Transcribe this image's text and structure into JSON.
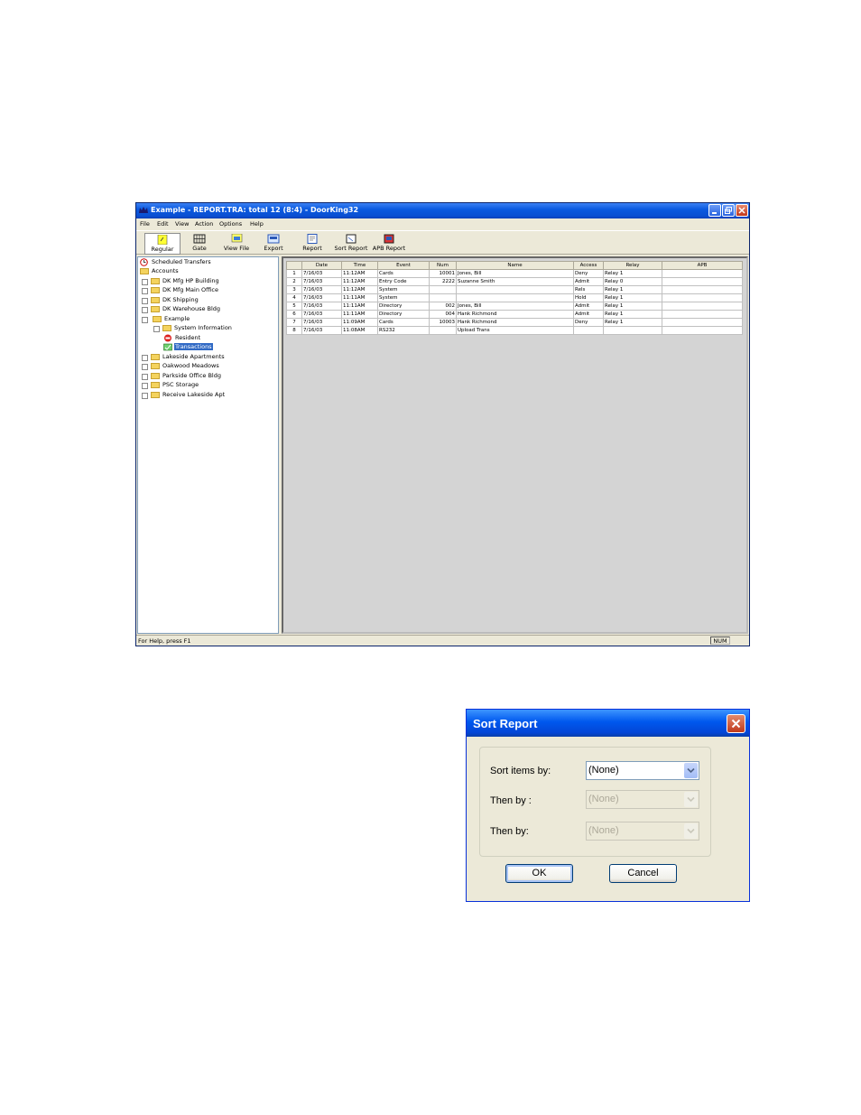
{
  "window": {
    "title": "Example - REPORT.TRA: total 12 (8:4) - DoorKing32",
    "menu": [
      "File",
      "Edit",
      "View",
      "Action",
      "Options",
      "Help"
    ],
    "toolbar": [
      {
        "label": "Regular",
        "icon": "regular-icon"
      },
      {
        "label": "Gate",
        "icon": "gate-icon"
      },
      {
        "label": "View File",
        "icon": "view-file-icon"
      },
      {
        "label": "Export",
        "icon": "export-icon"
      },
      {
        "label": "Report",
        "icon": "report-icon"
      },
      {
        "label": "Sort Report",
        "icon": "sort-report-icon"
      },
      {
        "label": "APB Report",
        "icon": "apb-report-icon"
      }
    ],
    "tree": [
      {
        "label": "Scheduled Transfers"
      },
      {
        "label": "Accounts"
      },
      {
        "label": "DK Mfg HP Building"
      },
      {
        "label": "DK Mfg Main Office"
      },
      {
        "label": "DK Shipping"
      },
      {
        "label": "DK Warehouse Bldg"
      },
      {
        "label": "Example"
      },
      {
        "label": "System Information"
      },
      {
        "label": "Resident"
      },
      {
        "label": "Transactions"
      },
      {
        "label": "Lakeside Apartments"
      },
      {
        "label": "Oakwood Meadows"
      },
      {
        "label": "Parkside Office Bldg"
      },
      {
        "label": "PSC Storage"
      },
      {
        "label": "Receive Lakeside Apt"
      }
    ],
    "grid": {
      "columns": [
        "",
        "Date",
        "Time",
        "Event",
        "Num",
        "Name",
        "Access",
        "Relay",
        "APB"
      ],
      "rows": [
        [
          "1",
          "7/16/03",
          "11:12AM",
          "Cards",
          "10001",
          "Jones, Bill",
          "Deny",
          "Relay 1",
          ""
        ],
        [
          "2",
          "7/16/03",
          "11:12AM",
          "Entry Code",
          "2222",
          "Suzanne Smith",
          "Admit",
          "Relay 0",
          ""
        ],
        [
          "3",
          "7/16/03",
          "11:12AM",
          "System",
          "",
          "",
          "Rels",
          "Relay 1",
          ""
        ],
        [
          "4",
          "7/16/03",
          "11:11AM",
          "System",
          "",
          "",
          "Hold",
          "Relay 1",
          ""
        ],
        [
          "5",
          "7/16/03",
          "11:11AM",
          "Directory",
          "002",
          "Jones, Bill",
          "Admit",
          "Relay 1",
          ""
        ],
        [
          "6",
          "7/16/03",
          "11:11AM",
          "Directory",
          "004",
          "Hank Richmond",
          "Admit",
          "Relay 1",
          ""
        ],
        [
          "7",
          "7/16/03",
          "11:09AM",
          "Cards",
          "10003",
          "Hank Richmond",
          "Deny",
          "Relay 1",
          ""
        ],
        [
          "8",
          "7/16/03",
          "11:08AM",
          "RS232",
          "",
          "Upload Trans",
          "",
          "",
          ""
        ]
      ]
    },
    "status": {
      "help": "For Help, press F1",
      "num": "NUM"
    }
  },
  "dialog": {
    "title": "Sort Report",
    "fields": [
      {
        "label": "Sort items by:",
        "value": "(None)",
        "enabled": true
      },
      {
        "label": "Then by :",
        "value": "(None)",
        "enabled": false
      },
      {
        "label": "Then by:",
        "value": "(None)",
        "enabled": false
      }
    ],
    "ok": "OK",
    "cancel": "Cancel"
  },
  "colors": {
    "titlebar": "#0a4fd1",
    "selection": "#316ac5",
    "close": "#c2371a"
  }
}
